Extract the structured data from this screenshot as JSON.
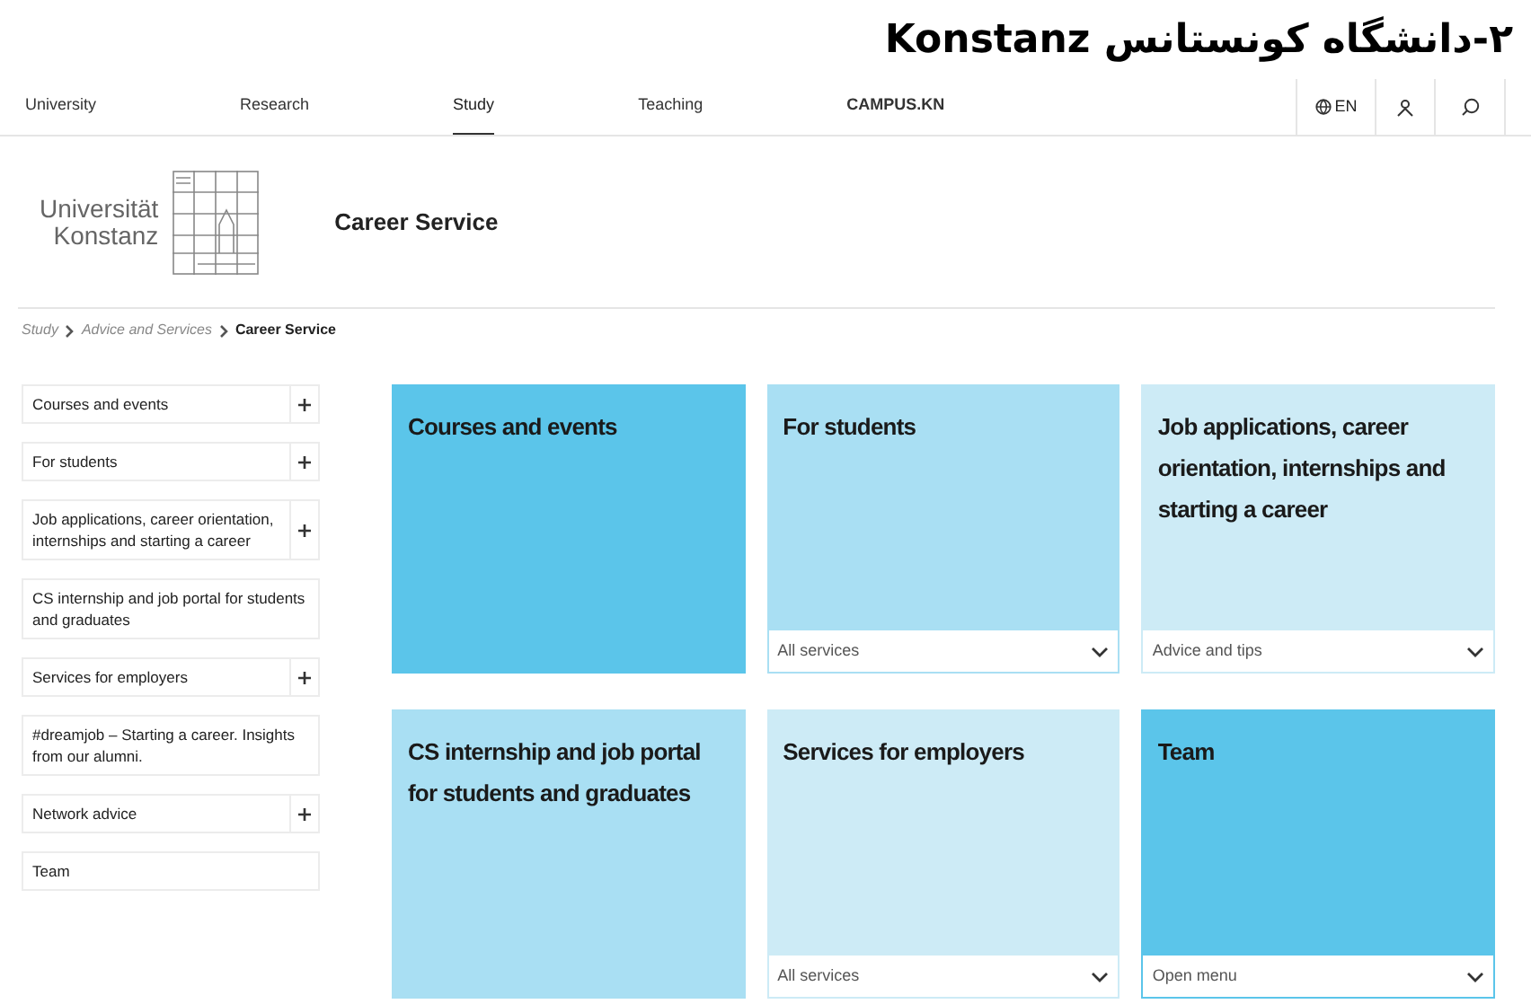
{
  "document_title": "۲-دانشگاه کونستانس Konstanz",
  "nav": {
    "items": [
      {
        "label": "University",
        "selected": false
      },
      {
        "label": "Research",
        "selected": false
      },
      {
        "label": "Study",
        "selected": true
      },
      {
        "label": "Teaching",
        "selected": false
      },
      {
        "label": "CAMPUS.KN",
        "selected": false
      }
    ],
    "language": "EN"
  },
  "header": {
    "logo_lines": [
      "Universität",
      "Konstanz"
    ],
    "title": "Career Service"
  },
  "breadcrumb": [
    {
      "label": "Study",
      "current": false
    },
    {
      "label": "Advice and Services",
      "current": false
    },
    {
      "label": "Career Service",
      "current": true
    }
  ],
  "sidebar": {
    "items": [
      {
        "label": "Courses and events",
        "kind": "expandable"
      },
      {
        "label": "For students",
        "kind": "expandable"
      },
      {
        "label": "Job applications, career orientation, internships and starting a career",
        "kind": "expandable"
      },
      {
        "label": "CS internship and job portal for students and graduates",
        "kind": "link"
      },
      {
        "label": "Services for employers",
        "kind": "expandable"
      },
      {
        "label": "#dreamjob – Starting a career. Insights from our alumni.",
        "kind": "link"
      },
      {
        "label": "Network advice",
        "kind": "expandable"
      },
      {
        "label": "Team",
        "kind": "link"
      }
    ]
  },
  "tiles": [
    {
      "title": "Courses and events",
      "color": "#5bc5ea"
    },
    {
      "title": "For students",
      "color": "#a9dff3",
      "menu": "All services"
    },
    {
      "title": "Job applications, career orientation, internships and starting a career",
      "color": "#cdebf6",
      "menu": "Advice and tips"
    },
    {
      "title": "CS internship and job portal for students and graduates",
      "color": "#a9dff3"
    },
    {
      "title": "Services for employers",
      "color": "#cdebf6",
      "menu": "All services"
    },
    {
      "title": "Team",
      "color": "#5bc5ea",
      "menu": "Open menu"
    }
  ]
}
